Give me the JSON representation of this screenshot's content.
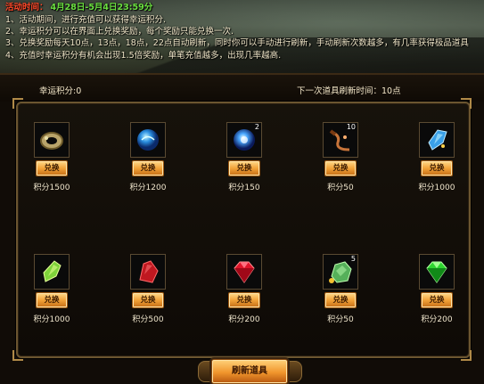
{
  "activity": {
    "tag": "活动时间：",
    "date": "4月28日-5月4日23:59分",
    "rules": [
      "1、活动期间，进行充值可以获得幸运积分.",
      "2、幸运积分可以在界面上兑换奖励，每个奖励只能兑换一次.",
      "3、兑换奖励每天10点，13点，18点，22点自动刷新，同时你可以手动进行刷新，手动刷新次数越多，有几率获得极品道具",
      "4、充值时幸运积分有机会出现1.5倍奖励，单笔充值越多，出现几率越高."
    ]
  },
  "status": {
    "lucky_points": "幸运积分:0",
    "next_refresh": "下一次道具刷新时间：10点"
  },
  "items": [
    {
      "name": "jade-bracelet",
      "button": "兑换",
      "points": "积分1500",
      "qty": ""
    },
    {
      "name": "blue-orb",
      "button": "兑换",
      "points": "积分1200",
      "qty": ""
    },
    {
      "name": "blue-crystal-ball",
      "button": "兑换",
      "points": "积分150",
      "qty": "2"
    },
    {
      "name": "whip",
      "button": "兑换",
      "points": "积分50",
      "qty": "10"
    },
    {
      "name": "blue-shard",
      "button": "兑换",
      "points": "积分1000",
      "qty": ""
    },
    {
      "name": "green-crystal",
      "button": "兑换",
      "points": "积分1000",
      "qty": ""
    },
    {
      "name": "red-shard",
      "button": "兑换",
      "points": "积分500",
      "qty": ""
    },
    {
      "name": "ruby",
      "button": "兑换",
      "points": "积分200",
      "qty": ""
    },
    {
      "name": "jade-ore",
      "button": "兑换",
      "points": "积分50",
      "qty": "5"
    },
    {
      "name": "emerald",
      "button": "兑换",
      "points": "积分200",
      "qty": ""
    }
  ],
  "refresh_button": "刷新道具",
  "colors": {
    "accent": "#f2a238",
    "panel_border": "#6b5530",
    "activity_tag": "#ff4a2a",
    "date": "#6be040"
  }
}
